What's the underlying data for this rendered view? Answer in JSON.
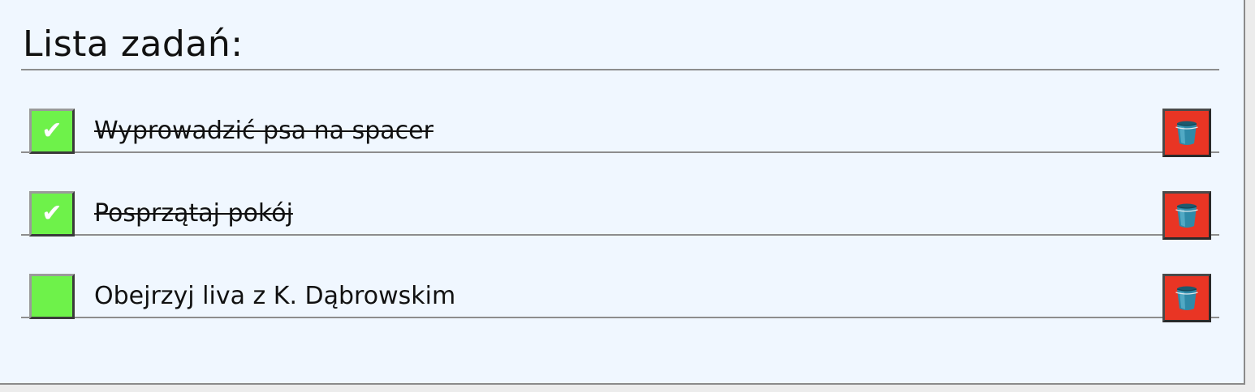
{
  "header": {
    "title": "Lista zadań:"
  },
  "tasks": [
    {
      "text": "Wyprowadzić psa na spacer",
      "done": true,
      "check_glyph": "✔"
    },
    {
      "text": "Posprzątaj pokój",
      "done": true,
      "check_glyph": "✔"
    },
    {
      "text": "Obejrzyj liva z K. Dąbrowskim",
      "done": false,
      "check_glyph": ""
    }
  ],
  "icons": {
    "check": "check-icon",
    "delete": "bucket-icon"
  },
  "colors": {
    "panel_background": "#f0f7ff",
    "checkbox_green": "#6ef24a",
    "delete_red": "#e93524",
    "divider": "#8d8d8d"
  }
}
